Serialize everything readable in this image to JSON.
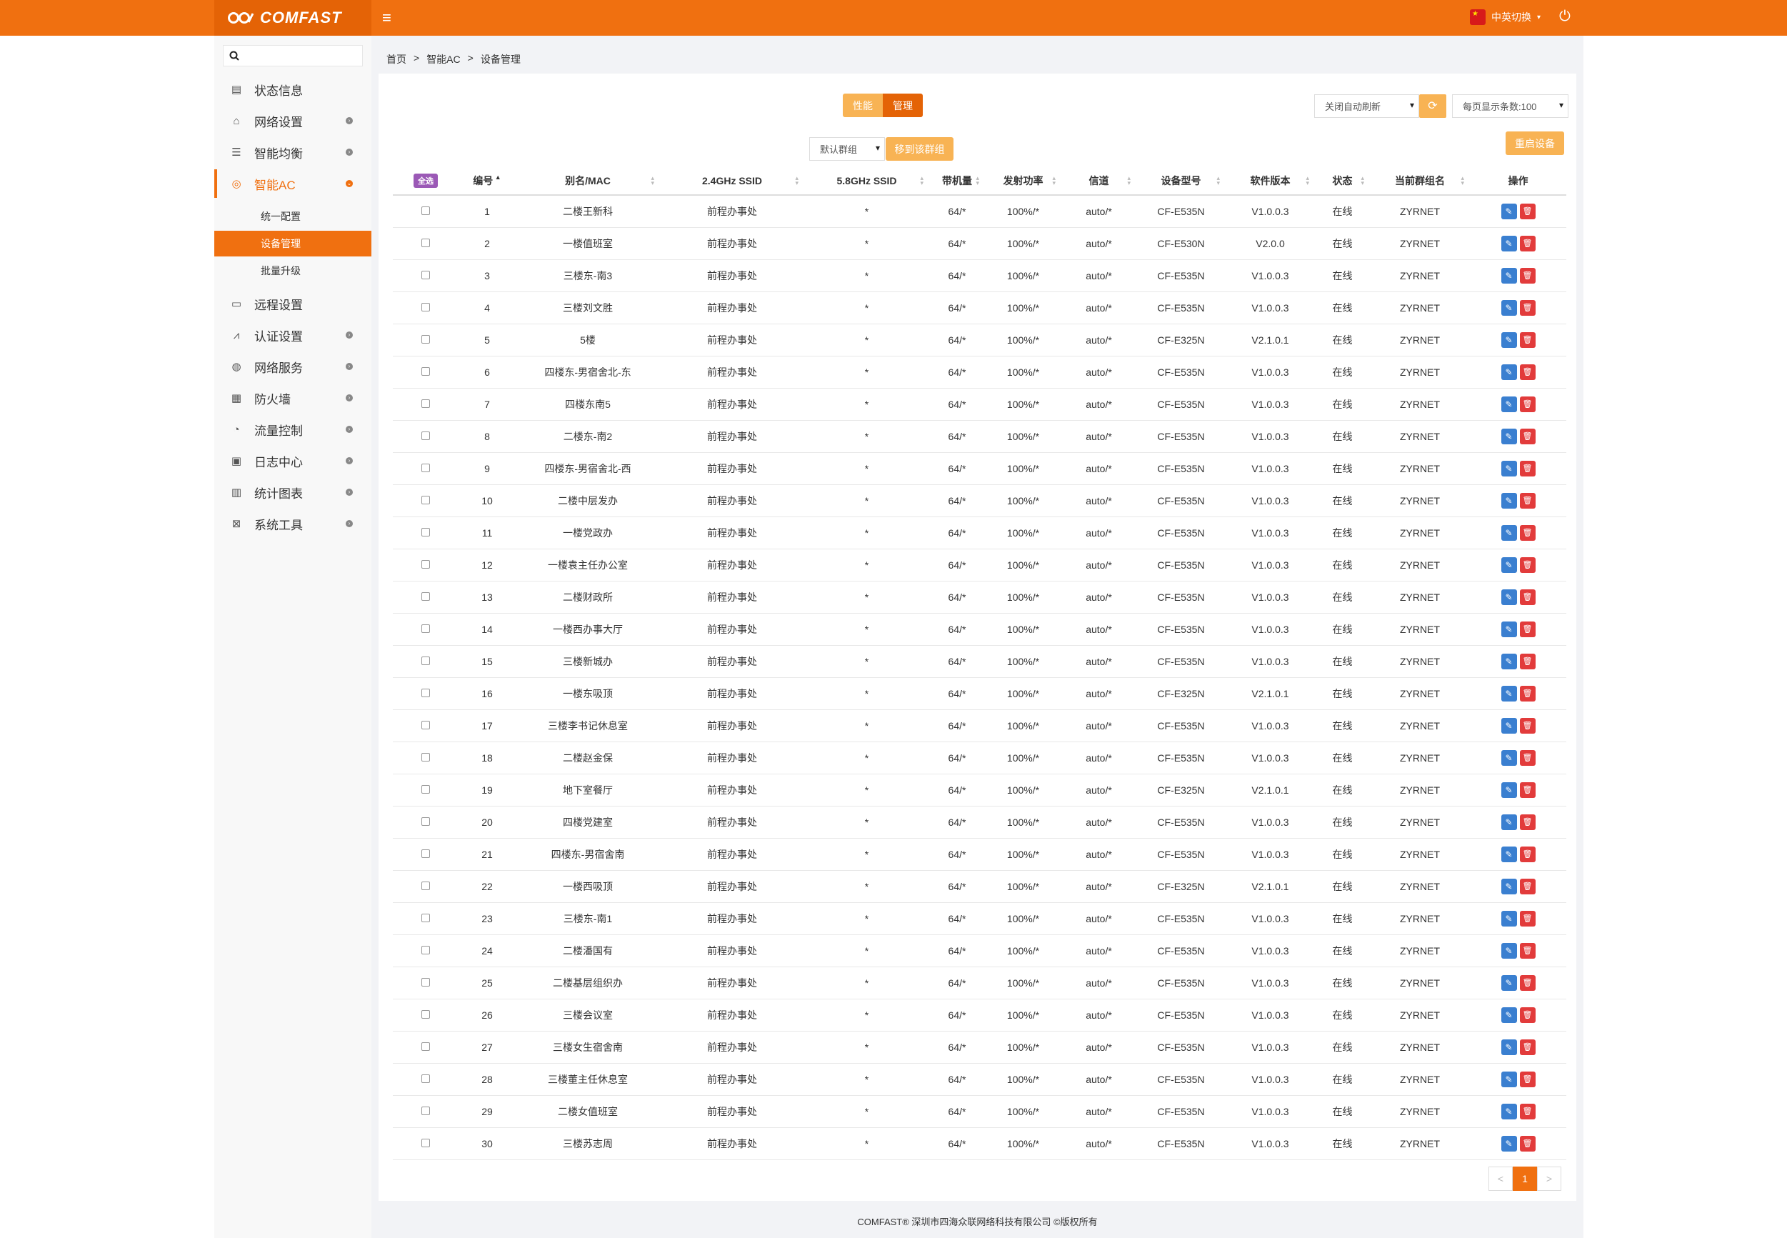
{
  "header": {
    "logo_text": "COMFAST",
    "lang_label": "中英切换"
  },
  "search": {
    "placeholder": ""
  },
  "sidebar": {
    "items": [
      {
        "label": "状态信息",
        "icon": "clipboard-icon"
      },
      {
        "label": "网络设置",
        "icon": "router-icon"
      },
      {
        "label": "智能均衡",
        "icon": "list-icon"
      },
      {
        "label": "智能AC",
        "icon": "target-icon"
      },
      {
        "label": "远程设置",
        "icon": "monitor-icon"
      },
      {
        "label": "认证设置",
        "icon": "chart-icon"
      },
      {
        "label": "网络服务",
        "icon": "globe-icon"
      },
      {
        "label": "防火墙",
        "icon": "firewall-icon"
      },
      {
        "label": "流量控制",
        "icon": "gauge-icon"
      },
      {
        "label": "日志中心",
        "icon": "log-icon"
      },
      {
        "label": "统计图表",
        "icon": "stats-icon"
      },
      {
        "label": "系统工具",
        "icon": "tools-icon"
      }
    ],
    "subitems": [
      "统一配置",
      "设备管理",
      "批量升级"
    ]
  },
  "breadcrumb": {
    "home": "首页",
    "level1": "智能AC",
    "level2": "设备管理",
    "sep": ">"
  },
  "toolbar": {
    "tab_perf": "性能",
    "tab_manage": "管理",
    "auto_refresh": "关闭自动刷新",
    "page_size": "每页显示条数:100",
    "group_select": "默认群组",
    "move_group": "移到该群组",
    "reboot": "重启设备"
  },
  "table": {
    "select_all": "全选",
    "headers": [
      "编号",
      "别名/MAC",
      "2.4GHz SSID",
      "5.8GHz SSID",
      "带机量",
      "发射功率",
      "信道",
      "设备型号",
      "软件版本",
      "状态",
      "当前群组名",
      "操作"
    ],
    "rows": [
      {
        "id": "1",
        "name": "二楼王新科",
        "ssid24": "前程办事处",
        "ssid58": "*",
        "load": "64/*",
        "power": "100%/*",
        "channel": "auto/*",
        "model": "CF-E535N",
        "version": "V1.0.0.3",
        "status": "在线",
        "group": "ZYRNET"
      },
      {
        "id": "2",
        "name": "一楼值班室",
        "ssid24": "前程办事处",
        "ssid58": "*",
        "load": "64/*",
        "power": "100%/*",
        "channel": "auto/*",
        "model": "CF-E530N",
        "version": "V2.0.0",
        "status": "在线",
        "group": "ZYRNET"
      },
      {
        "id": "3",
        "name": "三楼东-南3",
        "ssid24": "前程办事处",
        "ssid58": "*",
        "load": "64/*",
        "power": "100%/*",
        "channel": "auto/*",
        "model": "CF-E535N",
        "version": "V1.0.0.3",
        "status": "在线",
        "group": "ZYRNET"
      },
      {
        "id": "4",
        "name": "三楼刘文胜",
        "ssid24": "前程办事处",
        "ssid58": "*",
        "load": "64/*",
        "power": "100%/*",
        "channel": "auto/*",
        "model": "CF-E535N",
        "version": "V1.0.0.3",
        "status": "在线",
        "group": "ZYRNET"
      },
      {
        "id": "5",
        "name": "5楼",
        "ssid24": "前程办事处",
        "ssid58": "*",
        "load": "64/*",
        "power": "100%/*",
        "channel": "auto/*",
        "model": "CF-E325N",
        "version": "V2.1.0.1",
        "status": "在线",
        "group": "ZYRNET"
      },
      {
        "id": "6",
        "name": "四楼东-男宿舍北-东",
        "ssid24": "前程办事处",
        "ssid58": "*",
        "load": "64/*",
        "power": "100%/*",
        "channel": "auto/*",
        "model": "CF-E535N",
        "version": "V1.0.0.3",
        "status": "在线",
        "group": "ZYRNET"
      },
      {
        "id": "7",
        "name": "四楼东南5",
        "ssid24": "前程办事处",
        "ssid58": "*",
        "load": "64/*",
        "power": "100%/*",
        "channel": "auto/*",
        "model": "CF-E535N",
        "version": "V1.0.0.3",
        "status": "在线",
        "group": "ZYRNET"
      },
      {
        "id": "8",
        "name": "二楼东-南2",
        "ssid24": "前程办事处",
        "ssid58": "*",
        "load": "64/*",
        "power": "100%/*",
        "channel": "auto/*",
        "model": "CF-E535N",
        "version": "V1.0.0.3",
        "status": "在线",
        "group": "ZYRNET"
      },
      {
        "id": "9",
        "name": "四楼东-男宿舍北-西",
        "ssid24": "前程办事处",
        "ssid58": "*",
        "load": "64/*",
        "power": "100%/*",
        "channel": "auto/*",
        "model": "CF-E535N",
        "version": "V1.0.0.3",
        "status": "在线",
        "group": "ZYRNET"
      },
      {
        "id": "10",
        "name": "二楼中层发办",
        "ssid24": "前程办事处",
        "ssid58": "*",
        "load": "64/*",
        "power": "100%/*",
        "channel": "auto/*",
        "model": "CF-E535N",
        "version": "V1.0.0.3",
        "status": "在线",
        "group": "ZYRNET"
      },
      {
        "id": "11",
        "name": "一楼党政办",
        "ssid24": "前程办事处",
        "ssid58": "*",
        "load": "64/*",
        "power": "100%/*",
        "channel": "auto/*",
        "model": "CF-E535N",
        "version": "V1.0.0.3",
        "status": "在线",
        "group": "ZYRNET"
      },
      {
        "id": "12",
        "name": "一楼袁主任办公室",
        "ssid24": "前程办事处",
        "ssid58": "*",
        "load": "64/*",
        "power": "100%/*",
        "channel": "auto/*",
        "model": "CF-E535N",
        "version": "V1.0.0.3",
        "status": "在线",
        "group": "ZYRNET"
      },
      {
        "id": "13",
        "name": "二楼财政所",
        "ssid24": "前程办事处",
        "ssid58": "*",
        "load": "64/*",
        "power": "100%/*",
        "channel": "auto/*",
        "model": "CF-E535N",
        "version": "V1.0.0.3",
        "status": "在线",
        "group": "ZYRNET"
      },
      {
        "id": "14",
        "name": "一楼西办事大厅",
        "ssid24": "前程办事处",
        "ssid58": "*",
        "load": "64/*",
        "power": "100%/*",
        "channel": "auto/*",
        "model": "CF-E535N",
        "version": "V1.0.0.3",
        "status": "在线",
        "group": "ZYRNET"
      },
      {
        "id": "15",
        "name": "三楼新城办",
        "ssid24": "前程办事处",
        "ssid58": "*",
        "load": "64/*",
        "power": "100%/*",
        "channel": "auto/*",
        "model": "CF-E535N",
        "version": "V1.0.0.3",
        "status": "在线",
        "group": "ZYRNET"
      },
      {
        "id": "16",
        "name": "一楼东吸顶",
        "ssid24": "前程办事处",
        "ssid58": "*",
        "load": "64/*",
        "power": "100%/*",
        "channel": "auto/*",
        "model": "CF-E325N",
        "version": "V2.1.0.1",
        "status": "在线",
        "group": "ZYRNET"
      },
      {
        "id": "17",
        "name": "三楼李书记休息室",
        "ssid24": "前程办事处",
        "ssid58": "*",
        "load": "64/*",
        "power": "100%/*",
        "channel": "auto/*",
        "model": "CF-E535N",
        "version": "V1.0.0.3",
        "status": "在线",
        "group": "ZYRNET"
      },
      {
        "id": "18",
        "name": "二楼赵金保",
        "ssid24": "前程办事处",
        "ssid58": "*",
        "load": "64/*",
        "power": "100%/*",
        "channel": "auto/*",
        "model": "CF-E535N",
        "version": "V1.0.0.3",
        "status": "在线",
        "group": "ZYRNET"
      },
      {
        "id": "19",
        "name": "地下室餐厅",
        "ssid24": "前程办事处",
        "ssid58": "*",
        "load": "64/*",
        "power": "100%/*",
        "channel": "auto/*",
        "model": "CF-E325N",
        "version": "V2.1.0.1",
        "status": "在线",
        "group": "ZYRNET"
      },
      {
        "id": "20",
        "name": "四楼党建室",
        "ssid24": "前程办事处",
        "ssid58": "*",
        "load": "64/*",
        "power": "100%/*",
        "channel": "auto/*",
        "model": "CF-E535N",
        "version": "V1.0.0.3",
        "status": "在线",
        "group": "ZYRNET"
      },
      {
        "id": "21",
        "name": "四楼东-男宿舍南",
        "ssid24": "前程办事处",
        "ssid58": "*",
        "load": "64/*",
        "power": "100%/*",
        "channel": "auto/*",
        "model": "CF-E535N",
        "version": "V1.0.0.3",
        "status": "在线",
        "group": "ZYRNET"
      },
      {
        "id": "22",
        "name": "一楼西吸顶",
        "ssid24": "前程办事处",
        "ssid58": "*",
        "load": "64/*",
        "power": "100%/*",
        "channel": "auto/*",
        "model": "CF-E325N",
        "version": "V2.1.0.1",
        "status": "在线",
        "group": "ZYRNET"
      },
      {
        "id": "23",
        "name": "三楼东-南1",
        "ssid24": "前程办事处",
        "ssid58": "*",
        "load": "64/*",
        "power": "100%/*",
        "channel": "auto/*",
        "model": "CF-E535N",
        "version": "V1.0.0.3",
        "status": "在线",
        "group": "ZYRNET"
      },
      {
        "id": "24",
        "name": "二楼潘国有",
        "ssid24": "前程办事处",
        "ssid58": "*",
        "load": "64/*",
        "power": "100%/*",
        "channel": "auto/*",
        "model": "CF-E535N",
        "version": "V1.0.0.3",
        "status": "在线",
        "group": "ZYRNET"
      },
      {
        "id": "25",
        "name": "二楼基层组织办",
        "ssid24": "前程办事处",
        "ssid58": "*",
        "load": "64/*",
        "power": "100%/*",
        "channel": "auto/*",
        "model": "CF-E535N",
        "version": "V1.0.0.3",
        "status": "在线",
        "group": "ZYRNET"
      },
      {
        "id": "26",
        "name": "三楼会议室",
        "ssid24": "前程办事处",
        "ssid58": "*",
        "load": "64/*",
        "power": "100%/*",
        "channel": "auto/*",
        "model": "CF-E535N",
        "version": "V1.0.0.3",
        "status": "在线",
        "group": "ZYRNET"
      },
      {
        "id": "27",
        "name": "三楼女生宿舍南",
        "ssid24": "前程办事处",
        "ssid58": "*",
        "load": "64/*",
        "power": "100%/*",
        "channel": "auto/*",
        "model": "CF-E535N",
        "version": "V1.0.0.3",
        "status": "在线",
        "group": "ZYRNET"
      },
      {
        "id": "28",
        "name": "三楼董主任休息室",
        "ssid24": "前程办事处",
        "ssid58": "*",
        "load": "64/*",
        "power": "100%/*",
        "channel": "auto/*",
        "model": "CF-E535N",
        "version": "V1.0.0.3",
        "status": "在线",
        "group": "ZYRNET"
      },
      {
        "id": "29",
        "name": "二楼女值班室",
        "ssid24": "前程办事处",
        "ssid58": "*",
        "load": "64/*",
        "power": "100%/*",
        "channel": "auto/*",
        "model": "CF-E535N",
        "version": "V1.0.0.3",
        "status": "在线",
        "group": "ZYRNET"
      },
      {
        "id": "30",
        "name": "三楼苏志周",
        "ssid24": "前程办事处",
        "ssid58": "*",
        "load": "64/*",
        "power": "100%/*",
        "channel": "auto/*",
        "model": "CF-E535N",
        "version": "V1.0.0.3",
        "status": "在线",
        "group": "ZYRNET"
      }
    ]
  },
  "pager": {
    "prev": "<",
    "current": "1",
    "next": ">"
  },
  "footer": {
    "text": "COMFAST® 深圳市四海众联网络科技有限公司 ©版权所有"
  },
  "colors": {
    "accent": "#f07010",
    "accent_dark": "#e46306",
    "accent_light": "#f8b354",
    "edit": "#3a7fd0",
    "delete": "#e23b3b",
    "select_all": "#9b59b6"
  }
}
